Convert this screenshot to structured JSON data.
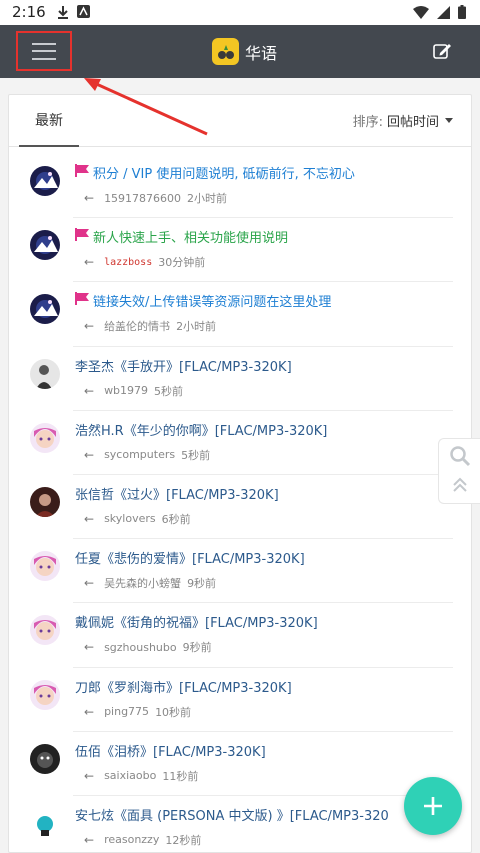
{
  "status_bar": {
    "time": "2:16"
  },
  "app": {
    "title": "华语",
    "accent": "#2fd1b6",
    "annotation_color": "#e5322d"
  },
  "tabs": {
    "active": "最新"
  },
  "sort": {
    "label": "排序:",
    "value": "回帖时间"
  },
  "threads": [
    {
      "title": "积分 / VIP 使用问题说明, 砥砺前行, 不忘初心",
      "user": "15917876600",
      "time": "2小时前",
      "pinned": true,
      "title_color": "#1e7fd3",
      "user_color": "#888888",
      "avatar": "galaxy"
    },
    {
      "title": "新人快速上手、相关功能使用说明",
      "user": "lazzboss",
      "time": "30分钟前",
      "pinned": true,
      "title_color": "#2aa44a",
      "user_color": "#d0362f",
      "avatar": "galaxy"
    },
    {
      "title": "链接失效/上传错误等资源问题在这里处理",
      "user": "给盖伦的情书",
      "time": "2小时前",
      "pinned": true,
      "title_color": "#1e7fd3",
      "user_color": "#888888",
      "avatar": "galaxy"
    },
    {
      "title": "李圣杰《手放开》[FLAC/MP3-320K]",
      "user": "wb1979",
      "time": "5秒前",
      "pinned": false,
      "title_color": "#2c5a8c",
      "user_color": "#888888",
      "avatar": "bw"
    },
    {
      "title": "浩然H.R《年少的你啊》[FLAC/MP3-320K]",
      "user": "sycomputers",
      "time": "5秒前",
      "pinned": false,
      "title_color": "#2c5a8c",
      "user_color": "#888888",
      "avatar": "anime"
    },
    {
      "title": "张信哲《过火》[FLAC/MP3-320K]",
      "user": "skylovers",
      "time": "6秒前",
      "pinned": false,
      "title_color": "#2c5a8c",
      "user_color": "#888888",
      "avatar": "dark"
    },
    {
      "title": "任夏《悲伤的爱情》[FLAC/MP3-320K]",
      "user": "吴先森的小螃蟹",
      "time": "9秒前",
      "pinned": false,
      "title_color": "#2c5a8c",
      "user_color": "#888888",
      "avatar": "anime"
    },
    {
      "title": "戴佩妮《街角的祝福》[FLAC/MP3-320K]",
      "user": "sgzhoushubo",
      "time": "9秒前",
      "pinned": false,
      "title_color": "#2c5a8c",
      "user_color": "#888888",
      "avatar": "anime"
    },
    {
      "title": "刀郎《罗刹海市》[FLAC/MP3-320K]",
      "user": "ping775",
      "time": "10秒前",
      "pinned": false,
      "title_color": "#2c5a8c",
      "user_color": "#888888",
      "avatar": "anime"
    },
    {
      "title": "伍佰《泪桥》[FLAC/MP3-320K]",
      "user": "saixiaobo",
      "time": "11秒前",
      "pinned": false,
      "title_color": "#2c5a8c",
      "user_color": "#888888",
      "avatar": "dog"
    },
    {
      "title": "安七炫《面具 (PERSONA 中文版) 》[FLAC/MP3-320",
      "user": "reasonzzy",
      "time": "12秒前",
      "pinned": false,
      "title_color": "#2c5a8c",
      "user_color": "#888888",
      "avatar": "teal"
    }
  ]
}
